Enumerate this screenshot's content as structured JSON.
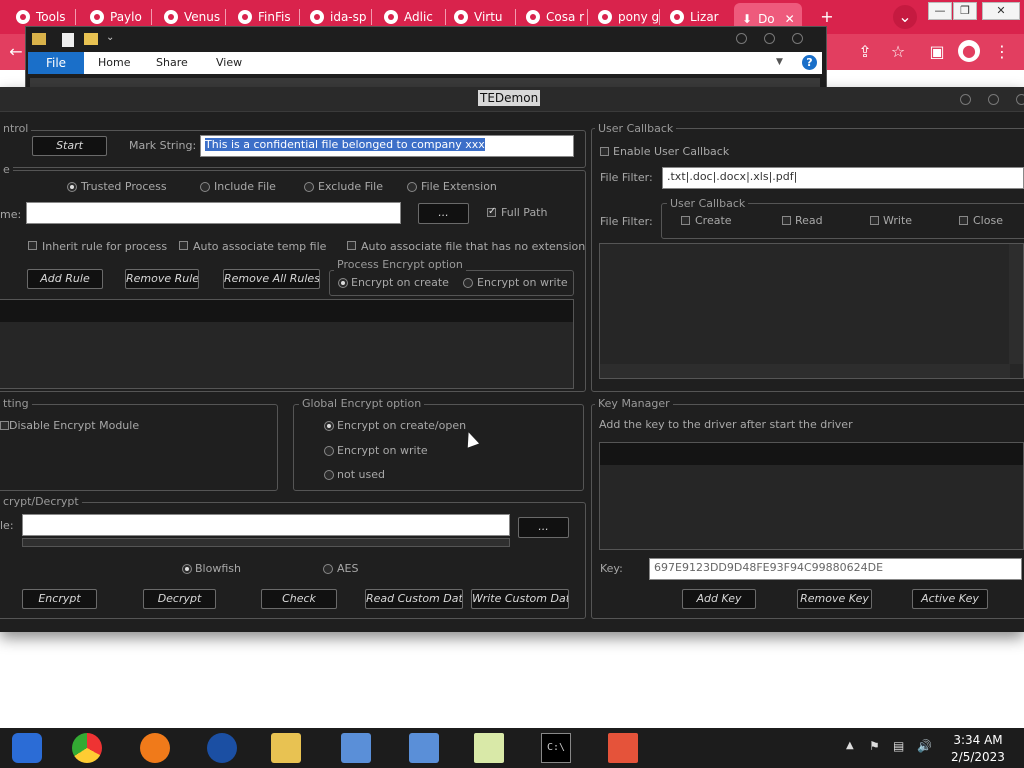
{
  "browser": {
    "tabs": [
      "Tools",
      "Paylo",
      "Venus",
      "FinFis",
      "ida-sp",
      "Adlic",
      "Virtu",
      "Cosa r",
      "pony g",
      "Lizar",
      "Do"
    ],
    "new_tab": "+",
    "close": "✕",
    "dropdown": "⌄"
  },
  "explorer": {
    "tabs": {
      "file": "File",
      "home": "Home",
      "share": "Share",
      "view": "View"
    },
    "help": "?"
  },
  "app": {
    "title": "TEDemon",
    "control": {
      "label": "ntrol",
      "start": "Start",
      "mark_label": "Mark String:",
      "mark_value": "This is a confidential file belonged to company xxx"
    },
    "rule": {
      "label": "e",
      "radios": [
        "Trusted Process",
        "Include File",
        "Exclude File",
        "File Extension"
      ],
      "name_label": "me:",
      "browse": "...",
      "full_path": "Full Path",
      "checks": [
        "Inherit rule for process",
        "Auto associate temp file",
        "Auto associate file that has no extension"
      ],
      "add": "Add Rule",
      "remove": "Remove Rule",
      "remove_all": "Remove All Rules",
      "pe_label": "Process Encrypt option",
      "pe_create": "Encrypt on create",
      "pe_write": "Encrypt on write"
    },
    "setting": {
      "label": "tting",
      "disable": "Disable Encrypt Module"
    },
    "global": {
      "label": "Global Encrypt option",
      "opt1": "Encrypt on create/open",
      "opt2": "Encrypt on write",
      "opt3": "not used"
    },
    "encdec": {
      "label": "crypt/Decrypt",
      "file_label": "le:",
      "browse": "...",
      "blowfish": "Blowfish",
      "aes": "AES",
      "encrypt": "Encrypt",
      "decrypt": "Decrypt",
      "check": "Check",
      "read": "Read Custom Data",
      "write": "Write Custom Data"
    },
    "callback": {
      "label": "User Callback",
      "enable": "Enable User Callback",
      "filter_label": "File Filter:",
      "filter_value": ".txt|.doc|.docx|.xls|.pdf|",
      "filter_label2": "File Filter:",
      "inner_label": "User Callback",
      "create": "Create",
      "read": "Read",
      "write": "Write",
      "close": "Close"
    },
    "keys": {
      "label": "Key Manager",
      "desc": "Add the key to the driver after start the driver",
      "key_label": "Key:",
      "key_value": "697E9123DD9D48FE93F94C99880624DE",
      "add": "Add Key",
      "remove": "Remove Key",
      "active": "Active Key"
    }
  },
  "taskbar": {
    "time": "3:34 AM",
    "date": "2/5/2023"
  }
}
